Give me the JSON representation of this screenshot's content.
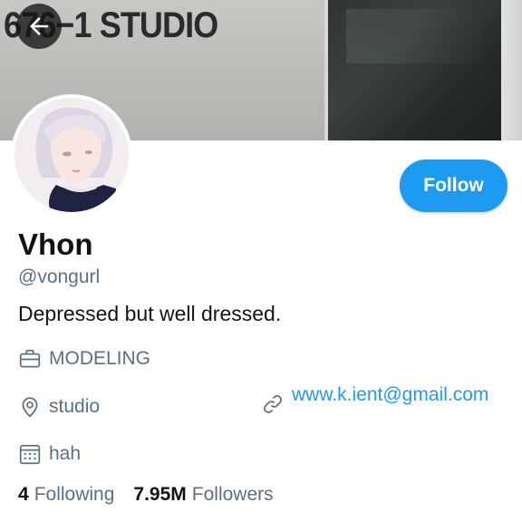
{
  "banner": {
    "sign_text": "676−1 STUDIO"
  },
  "header": {
    "back_icon": "arrow-left-icon"
  },
  "profile": {
    "name": "Vhon",
    "handle": "@vongurl",
    "bio": "Depressed but well dressed.",
    "category": "MODELING",
    "location": "studio",
    "website": "www.k.ient@gmail.com",
    "joined": "hah",
    "following_count": "4",
    "following_label": "Following",
    "followers_count": "7.95M",
    "followers_label": "Followers"
  },
  "actions": {
    "follow_label": "Follow"
  },
  "icons": {
    "category": "briefcase-icon",
    "location": "location-pin-icon",
    "website": "link-icon",
    "joined": "calendar-icon"
  },
  "colors": {
    "accent": "#1d9bf0",
    "secondary_text": "#5b7083",
    "primary_text": "#111111"
  }
}
